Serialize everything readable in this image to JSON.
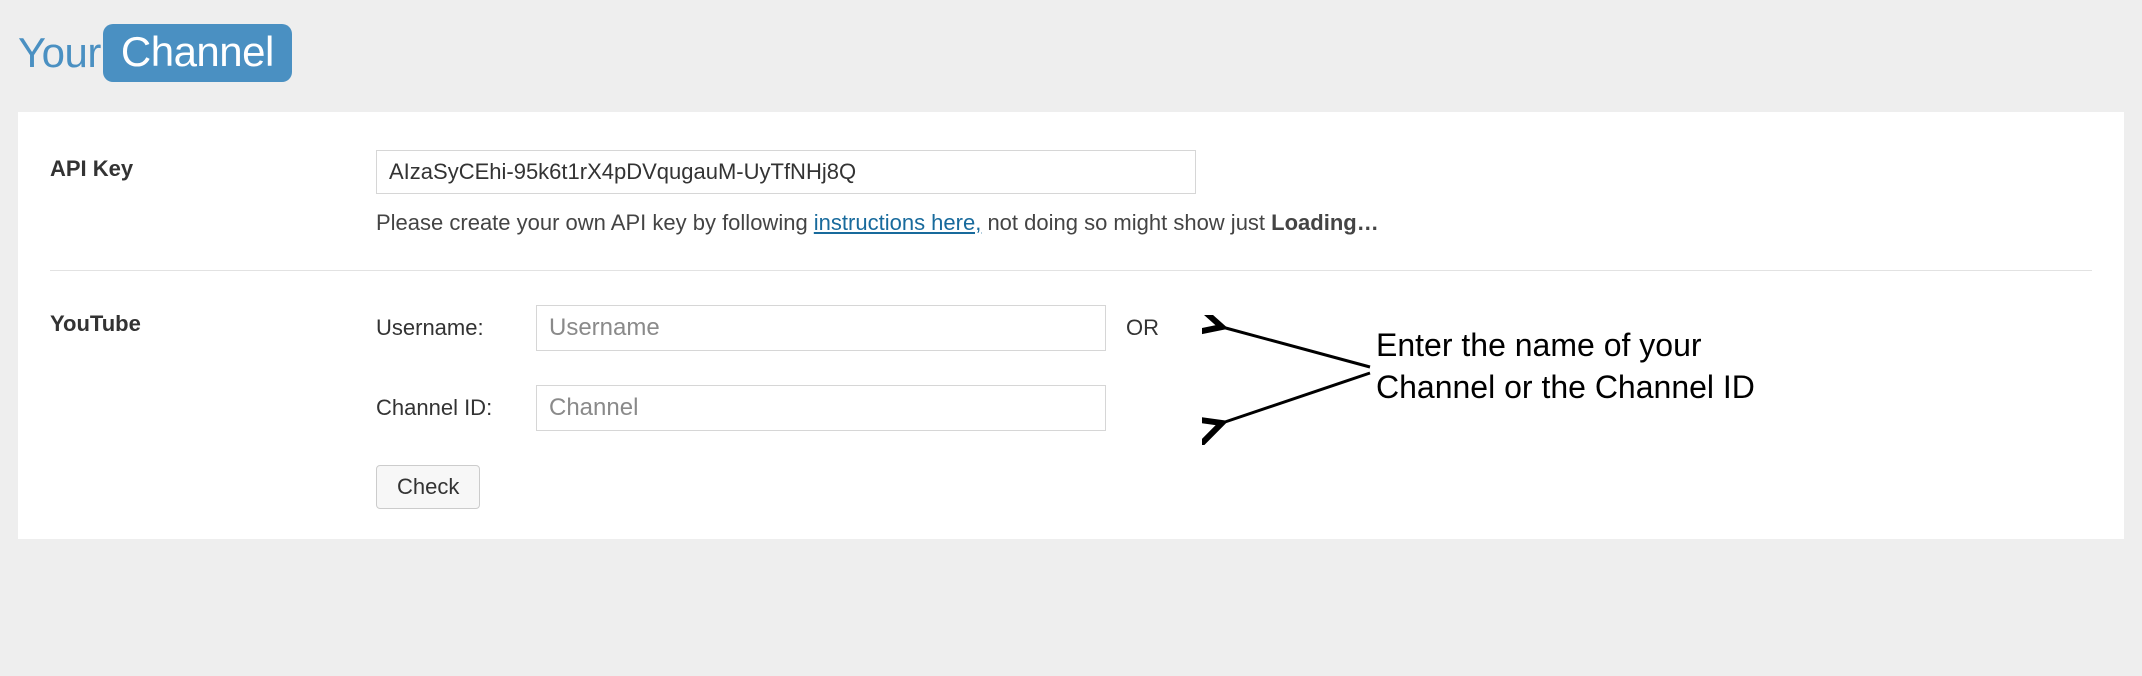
{
  "logo": {
    "left": "Your",
    "right": "Channel"
  },
  "apikey": {
    "label": "API Key",
    "value": "AIzaSyCEhi-95k6t1rX4pDVqugauM-UyTfNHj8Q",
    "hint_pre": "Please create your own API key by following ",
    "hint_link": "instructions here,",
    "hint_post": " not doing so might show just ",
    "hint_bold": "Loading…"
  },
  "youtube": {
    "label": "YouTube",
    "username_label": "Username:",
    "username_placeholder": "Username",
    "or": "OR",
    "channel_label": "Channel ID:",
    "channel_placeholder": "Channel",
    "check": "Check"
  },
  "annotation": {
    "line1": "Enter the name of your",
    "line2": "Channel or the Channel ID"
  }
}
